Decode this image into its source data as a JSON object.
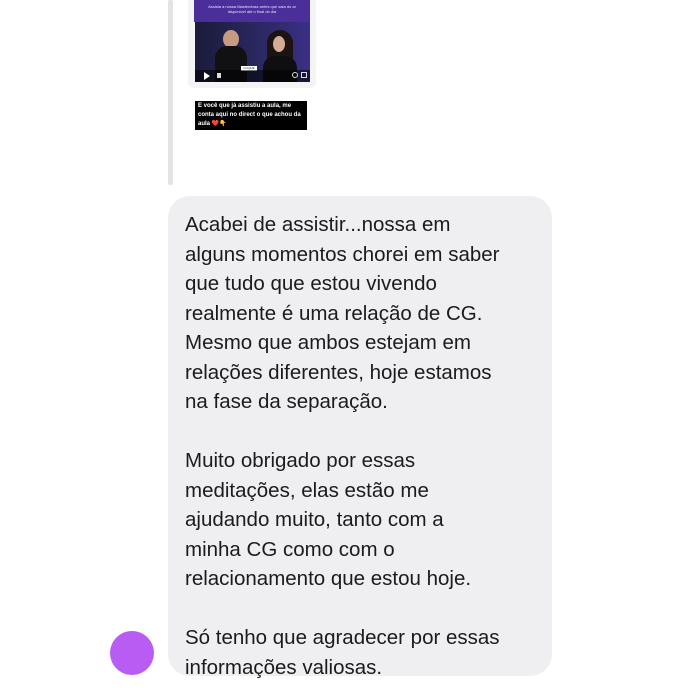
{
  "colors": {
    "bubble_background": "#efeff1",
    "avatar": "#b95cf4",
    "story_header": "#4a2f9a",
    "text": "#1b1b1b"
  },
  "reply_story": {
    "header_text": [
      "Assista a nossa Masterclass antes que saia do ar",
      "disponível até o final do dia"
    ],
    "video_caption": "CLIQUE",
    "icons": [
      "play-icon",
      "volume-icon",
      "settings-icon",
      "fullscreen-icon"
    ],
    "sticker_lines": [
      "E você que já assistiu a aula, me",
      "conta aqui no direct o que achou da",
      "aula ❤️👇"
    ]
  },
  "message": {
    "paragraphs": [
      [
        "Acabei de assistir...nossa em",
        "alguns momentos chorei em saber",
        "que tudo que estou vivendo",
        "realmente é uma relação de CG.",
        "Mesmo que ambos estejam em",
        "relações diferentes, hoje estamos",
        "na fase da separação."
      ],
      [
        "Muito obrigado por essas",
        "meditações, elas estão me",
        "ajudando muito, tanto com a",
        "minha CG como com o",
        "relacionamento que estou hoje."
      ],
      [
        "Só tenho que agradecer por essas",
        "informações valiosas."
      ]
    ]
  }
}
